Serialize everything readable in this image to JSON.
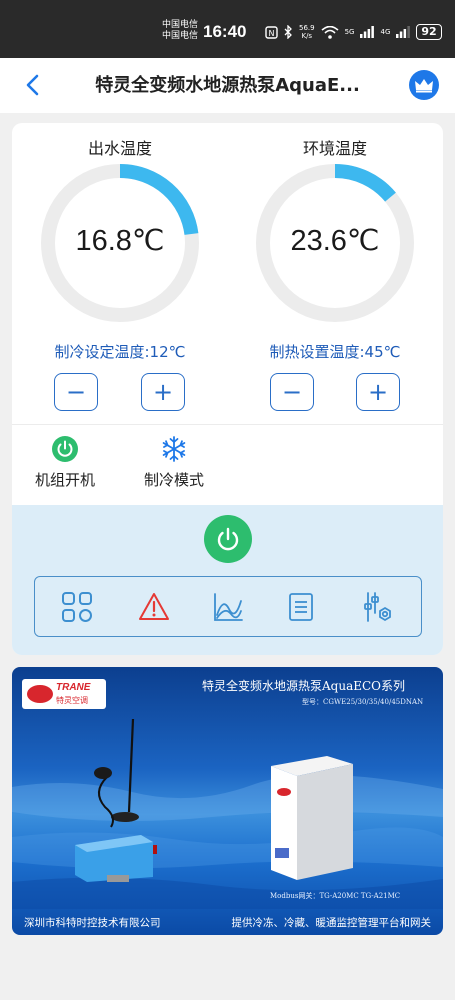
{
  "status_bar": {
    "carrier1": "中国电信",
    "carrier2": "中国电信",
    "time": "16:40",
    "net_speed_value": "56.9",
    "net_speed_unit": "K/s",
    "signal1": "5G",
    "signal2": "4G",
    "battery": "92"
  },
  "nav": {
    "title": "特灵全变频水地源热泵AquaE...",
    "back_icon": "chevron-left-icon",
    "crown_icon": "crown-icon"
  },
  "gauges": [
    {
      "label": "出水温度",
      "value": "16.8℃",
      "fill_fraction": 0.23,
      "setpoint_label": "制冷设定温度:12℃",
      "minus_label": "−",
      "plus_label": "+"
    },
    {
      "label": "环境温度",
      "value": "23.6℃",
      "fill_fraction": 0.14,
      "setpoint_label": "制热设置温度:45℃",
      "minus_label": "−",
      "plus_label": "+"
    }
  ],
  "status": {
    "unit_power_label": "机组开机",
    "mode_label": "制冷模式"
  },
  "toolbar": {
    "items": [
      "dashboard-grid-icon",
      "alarm-warning-icon",
      "curve-chart-icon",
      "list-document-icon",
      "settings-sliders-icon"
    ]
  },
  "banner": {
    "logo_text": "TRANE",
    "logo_sub": "特灵空调",
    "title": "特灵全变频水地源热泵AquaECO系列",
    "models": "型号：CGWE25/30/35/40/45DNAN",
    "gateway_label": "Modbus网关：TG-A20MC TG-A21MC",
    "company": "深圳市科特时控技术有限公司",
    "slogan": "提供冷冻、冷藏、暖通监控管理平台和网关"
  },
  "colors": {
    "accent_blue": "#1f5cb8",
    "gauge_arc": "#3db8ef",
    "gauge_track": "#ececec",
    "power_green": "#2dbd6e",
    "alarm_red": "#e53935",
    "panel_blue": "#dcedf8"
  }
}
